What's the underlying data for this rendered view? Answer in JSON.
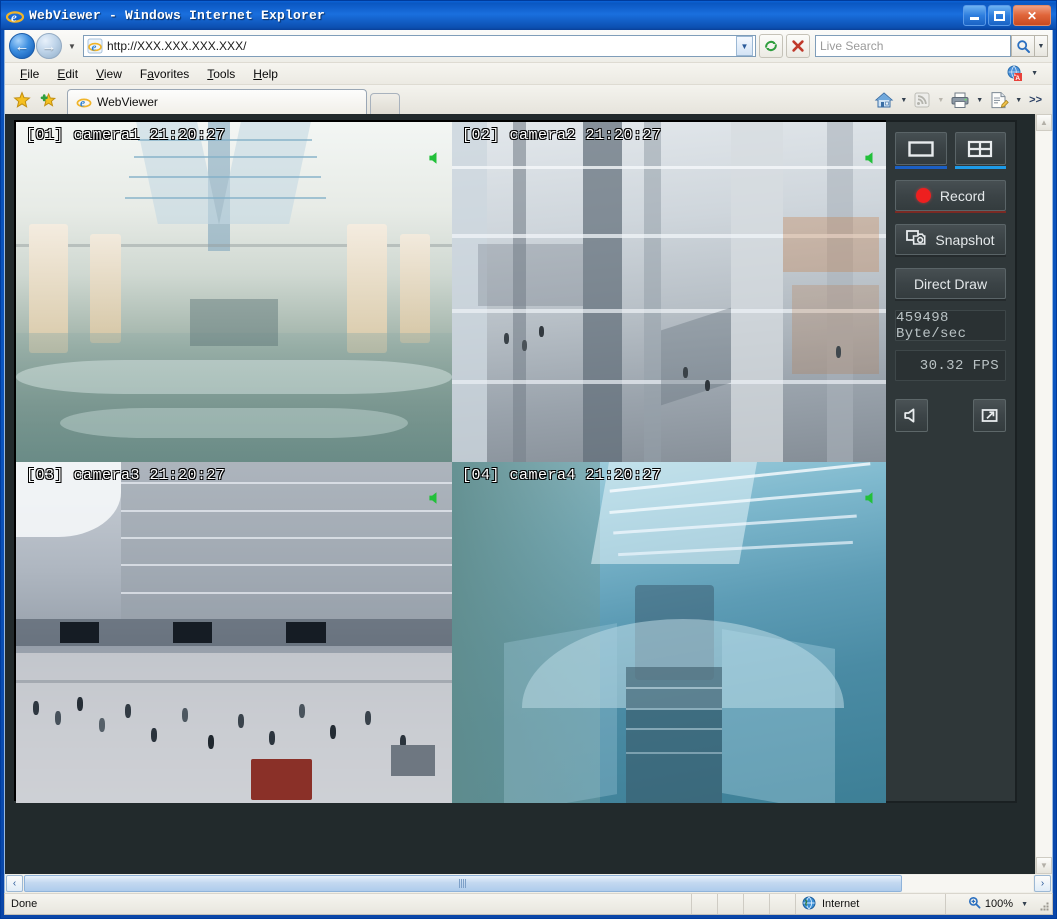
{
  "window": {
    "title": "WebViewer - Windows Internet Explorer",
    "minimize_label": "Minimize",
    "maximize_label": "Maximize",
    "close_label": "Close"
  },
  "nav": {
    "back_label": "Back",
    "forward_label": "Forward",
    "recent_pages_label": "Recent Pages",
    "address_value": "http://XXX.XXX.XXX.XXX/",
    "address_placeholder": "",
    "address_dropdown_label": "Address dropdown",
    "refresh_label": "Refresh",
    "stop_label": "Stop",
    "search_placeholder": "Live Search",
    "search_value": "",
    "search_go_label": "Search",
    "search_dropdown_label": "Search options"
  },
  "menu": {
    "items": [
      {
        "label": "File",
        "accel": "F"
      },
      {
        "label": "Edit",
        "accel": "E"
      },
      {
        "label": "View",
        "accel": "V"
      },
      {
        "label": "Favorites",
        "accel": "a"
      },
      {
        "label": "Tools",
        "accel": "T"
      },
      {
        "label": "Help",
        "accel": "H"
      }
    ]
  },
  "tabs": {
    "favorites_center_label": "Favorites Center",
    "add_favorite_label": "Add to Favorites",
    "items": [
      {
        "label": "WebViewer",
        "icon": "ie-icon",
        "active": true
      }
    ],
    "new_tab_label": "New Tab",
    "toolbar": [
      {
        "name": "home-icon",
        "label": "Home",
        "has_dropdown": true
      },
      {
        "name": "rss-icon",
        "label": "Feeds",
        "has_dropdown": true,
        "disabled": true
      },
      {
        "name": "print-icon",
        "label": "Print",
        "has_dropdown": true
      },
      {
        "name": "page-icon",
        "label": "Page",
        "has_dropdown": true
      }
    ],
    "overflow_label": ">>"
  },
  "viewer": {
    "cameras": [
      {
        "id": "01",
        "index_label": "[01]",
        "name": "camera1",
        "time": "21:20:27",
        "osd": "[01] camera1 21:20:27",
        "audio": true,
        "selected": true
      },
      {
        "id": "02",
        "index_label": "[02]",
        "name": "camera2",
        "time": "21:20:27",
        "osd": "[02] camera2 21:20:27",
        "audio": true,
        "selected": false
      },
      {
        "id": "03",
        "index_label": "[03]",
        "name": "camera3",
        "time": "21:20:27",
        "osd": "[03] camera3 21:20:27",
        "audio": true,
        "selected": false
      },
      {
        "id": "04",
        "index_label": "[04]",
        "name": "camera4",
        "time": "21:20:27",
        "osd": "[04] camera4 21:20:27",
        "audio": true,
        "selected": false
      }
    ],
    "panel": {
      "layout_single_label": "Single View",
      "layout_quad_label": "Quad View",
      "layout_single_active": false,
      "layout_quad_active": true,
      "record_label": "Record",
      "snapshot_label": "Snapshot",
      "direct_draw_label": "Direct Draw",
      "bitrate": "459498 Byte/sec",
      "fps": "30.32 FPS",
      "audio_label": "Audio",
      "fullscreen_label": "Full Screen"
    },
    "colors": {
      "panel_bg": "#2f3739",
      "selection": "#2196f3",
      "record_dot": "#ee1f1f",
      "quad_underline": "#1e9be8",
      "single_underline": "#1b5fc4",
      "record_underline": "#7a2a24",
      "osd_text": "#ffffff",
      "audio_icon": "#22c03a"
    }
  },
  "scrollbars": {
    "v_up_label": "Scroll up",
    "v_down_label": "Scroll down",
    "h_left_label": "Scroll left",
    "h_right_label": "Scroll right"
  },
  "statusbar": {
    "status": "Done",
    "zone": "Internet",
    "zoom": "100%",
    "zoom_dropdown_label": "Change Zoom Level"
  }
}
